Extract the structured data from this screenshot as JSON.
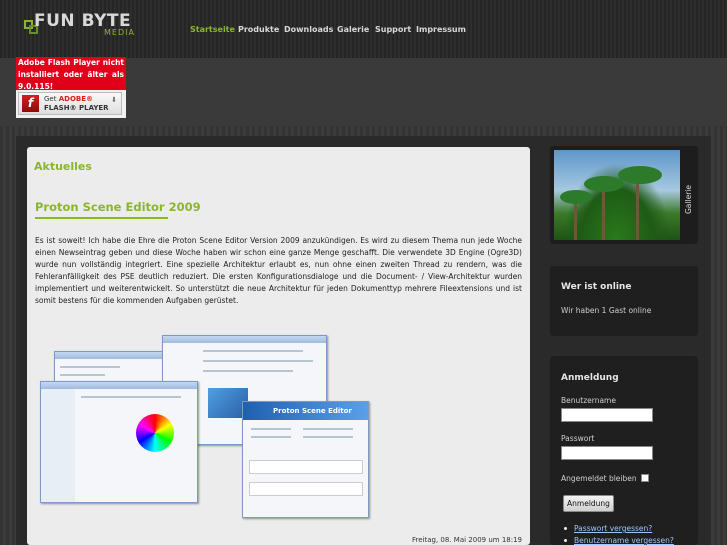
{
  "header": {
    "logo_name": "FUN BYTE",
    "logo_sub": "MEDIA",
    "nav": [
      "Startseite",
      "Produkte",
      "Downloads",
      "Galerie",
      "Support",
      "Impressum"
    ]
  },
  "flash": {
    "message": "Adobe Flash Player nicht installiert oder älter als 9.0.115!",
    "badge_get": "Get",
    "badge_adobe": "ADOBE®",
    "badge_player": "FLASH® PLAYER"
  },
  "content": {
    "heading": "Aktuelles",
    "article_title": "Proton Scene Editor 2009",
    "article_body": "Es ist soweit! Ich habe die Ehre die Proton Scene Editor Version 2009 anzukündigen. Es wird zu diesem Thema nun jede Woche einen Newseintrag geben und diese Woche haben wir schon eine ganze Menge geschafft. Die verwendete 3D Engine (Ogre3D) wurde nun vollständig integriert. Eine spezielle Architektur erlaubt es, nun ohne einen zweiten Thread zu rendern, was die Fehleranfälligkeit des PSE deutlich reduziert. Die ersten Konfigurationsdialoge und die Document- / View-Architektur wurden implementiert und weiterentwickelt. So unterstützt die neue Architektur für jeden Dokumenttyp mehrere Fileextensions und ist somit bestens für die kommenden Aufgaben gerüstet.",
    "screenshot_caption": "Proton Scene Editor",
    "date": "Freitag, 08. Mai 2009 um 18:19"
  },
  "sidebar": {
    "gallery_label": "Gallerie",
    "who_title": "Wer ist online",
    "who_text": "Wir haben 1 Gast online",
    "login_title": "Anmeldung",
    "username_label": "Benutzername",
    "password_label": "Passwort",
    "remember_label": "Angemeldet bleiben",
    "login_button": "Anmeldung",
    "links": [
      "Passwort vergessen?",
      "Benutzername vergessen?"
    ]
  },
  "colors": {
    "accent": "#8ab62c",
    "flash_red": "#e0001a",
    "link": "#9ec7ff"
  }
}
